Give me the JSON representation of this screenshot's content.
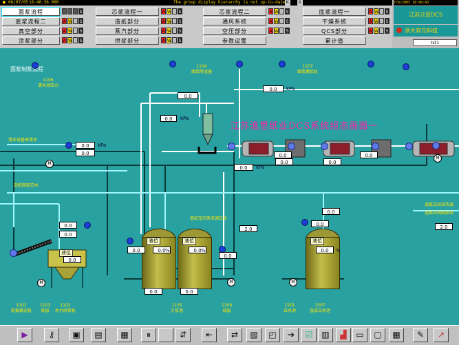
{
  "topbar": {
    "date": "06/07/05",
    "time": "16:40:36.000",
    "message": "The group display hierarchy is not up-to-date.",
    "k_label": "K",
    "x_label": "X",
    "right_time": "7/6/2005 16:40:43"
  },
  "nav": {
    "col1": [
      {
        "label": "面浆流程",
        "selected": true
      },
      {
        "label": "底浆流程二",
        "selected": false
      },
      {
        "label": "真空部分",
        "selected": false
      },
      {
        "label": "涂浆部分",
        "selected": false
      }
    ],
    "col2": [
      {
        "label": "芯浆流程一"
      },
      {
        "label": "造纸部分"
      },
      {
        "label": "蒸汽部分"
      },
      {
        "label": "供浆部分"
      }
    ],
    "col3": [
      {
        "label": "芯浆流程二"
      },
      {
        "label": "通风系统"
      },
      {
        "label": "空压部分"
      },
      {
        "label": "参数设置"
      }
    ],
    "col4": [
      {
        "label": "底浆流程一"
      },
      {
        "label": "干燥系统"
      },
      {
        "label": "QCS部分"
      },
      {
        "label": "累计值"
      }
    ],
    "ind_a": "A",
    "ind_w": "W",
    "ind_s": "S"
  },
  "rpanel": {
    "brand1": "江苏泛亚DCS",
    "brand2": "浙大双元科技",
    "field": "txt1"
  },
  "process": {
    "title": "面浆制浆流程",
    "wordart": "江苏淮里纸业DCS系统组态画面一",
    "tags": {
      "t1106": "1106\n清水池压力",
      "t1104": "1104\n面浆除渣器",
      "t1107": "1107\n面浆磨浆机",
      "clear_water": "清水总管来清水",
      "white_water": "造纸网部白水",
      "white_water_return": "造纸车间来浓调白水",
      "paper_machine_a": "造纸车间来浓调",
      "paper_machine_b": "造纸车间网部白"
    },
    "bottom": [
      {
        "num": "1101",
        "name": "链板输送机"
      },
      {
        "num": "1103",
        "name": "底层"
      },
      {
        "num": "1102",
        "name": "水力碎浆机"
      },
      {
        "num": "1105",
        "name": "方浆池"
      },
      {
        "num": "1106",
        "name": "底层"
      },
      {
        "num": "1501",
        "name": "白水池"
      },
      {
        "num": "1507",
        "name": "溢流白水池"
      }
    ],
    "level_label": "液位",
    "pct": "%",
    "kpa": "kPa",
    "values": {
      "v1": "0.0",
      "v2": "0.0",
      "v3": "0.0",
      "v4": "0.0",
      "v5": "0.0",
      "v6": "0.0",
      "v7": "0.0",
      "v8": "0.0",
      "v9": "0.0",
      "v10": "0.0",
      "v11": "0.0",
      "v12": "0.0",
      "v13": "0.0",
      "v14": "0.0",
      "v15": "0.0",
      "v16": "0.0",
      "v17": "2.0",
      "v18": "0.0",
      "v19": "2.0",
      "v20": "0.0",
      "v21": "0.0",
      "v22": "0.0",
      "v23": "0.0",
      "v24": "0.0"
    },
    "motor_label": "M"
  },
  "colors": {
    "background": "#2aa1a1",
    "pipe_white": "#ffffff",
    "pipe_cyan": "#9ff6ff",
    "pipe_dark": "#073b3b",
    "tank": "#b1ab3c",
    "wordart": "#ff1ea8"
  },
  "toolbar": {
    "icons": [
      "play-icon",
      "key-icon",
      "picture-icon",
      "document-icon",
      "grid-icon",
      "pause-icon",
      "blank-icon",
      "arrows-icon",
      "text-arrow-icon",
      "transfer-icon",
      "group-icon",
      "camera-icon",
      "checkbox-icon",
      "layout-icon",
      "chart-icon",
      "monitor-icon",
      "display-icon",
      "calendar-icon",
      "pen-icon",
      "trend-icon"
    ]
  }
}
